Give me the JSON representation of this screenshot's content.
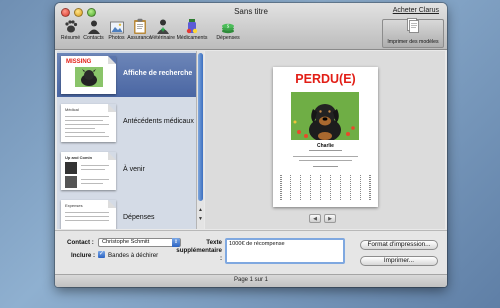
{
  "window": {
    "title": "Sans titre",
    "buy_link": "Acheter Clarus"
  },
  "toolbar": {
    "items": [
      {
        "label": "Résumé",
        "icon": "paw-icon"
      },
      {
        "label": "Contacts",
        "icon": "contacts-icon"
      },
      {
        "label": "Photos",
        "icon": "photos-icon"
      },
      {
        "label": "Assurance",
        "icon": "clipboard-icon"
      },
      {
        "label": "Vétérinaire",
        "icon": "veterinarian-icon"
      },
      {
        "label": "Médicaments",
        "icon": "medicine-icon"
      },
      {
        "label": "Dépenses",
        "icon": "money-icon"
      }
    ],
    "print_models_label": "Imprimer des modèles"
  },
  "sidebar": {
    "items": [
      {
        "label": "Affiche de recherche",
        "thumb_title": "MISSING",
        "selected": true
      },
      {
        "label": "Antécédents médicaux",
        "thumb_title": "Médical",
        "selected": false
      },
      {
        "label": "À venir",
        "thumb_title": "Up and Comin",
        "selected": false
      },
      {
        "label": "Dépenses",
        "thumb_title": "Expenses",
        "selected": false
      }
    ]
  },
  "preview": {
    "title": "PERDU(E)",
    "pet_name": "Charlie",
    "accent_color": "#e21e16"
  },
  "form": {
    "contact_label": "Contact :",
    "contact_value": "Christophe Schmitt",
    "include_label": "Inclure :",
    "include_checkbox_label": "Bandes à déchirer",
    "include_checked": true,
    "extra_text_label": "Texte supplémentaire :",
    "extra_text_value": "1000€ de récompense",
    "print_format_button": "Format d'impression...",
    "print_button": "Imprimer..."
  },
  "status": {
    "page_text": "Page 1 sur 1"
  }
}
